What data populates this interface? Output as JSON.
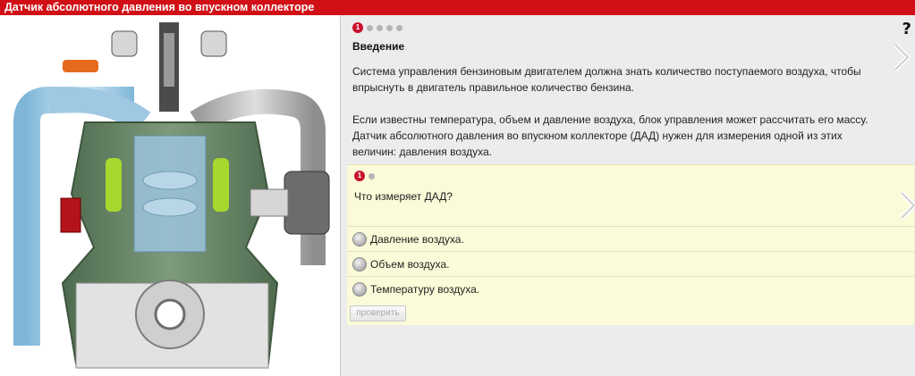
{
  "window": {
    "title": "Датчик абсолютного давления во впускном коллекторе"
  },
  "help": {
    "label": "?"
  },
  "intro": {
    "active_page": "1",
    "section_title": "Введение",
    "paragraph_1": "Система управления бензиновым двигателем должна знать количество поступаемого воздуха, чтобы впрыснуть в двигатель правильное количество бензина.",
    "paragraph_2": "Если известны температура, объем и давление воздуха, блок управления может рассчитать его массу. Датчик абсолютного давления во впускном коллекторе (ДАД) нужен для измерения одной из этих величин: давления воздуха."
  },
  "quiz": {
    "active_page": "1",
    "question": "Что измеряет ДАД?",
    "answers": [
      {
        "label": "Давление воздуха."
      },
      {
        "label": "Объем воздуха."
      },
      {
        "label": "Температуру воздуха."
      }
    ],
    "check_button": "проверить"
  },
  "illustration": {
    "subject": "engine-cutaway"
  },
  "colors": {
    "title_bar": "#d10f17",
    "quiz_bg": "#fbfbd9",
    "pane_bg": "#ececec"
  }
}
